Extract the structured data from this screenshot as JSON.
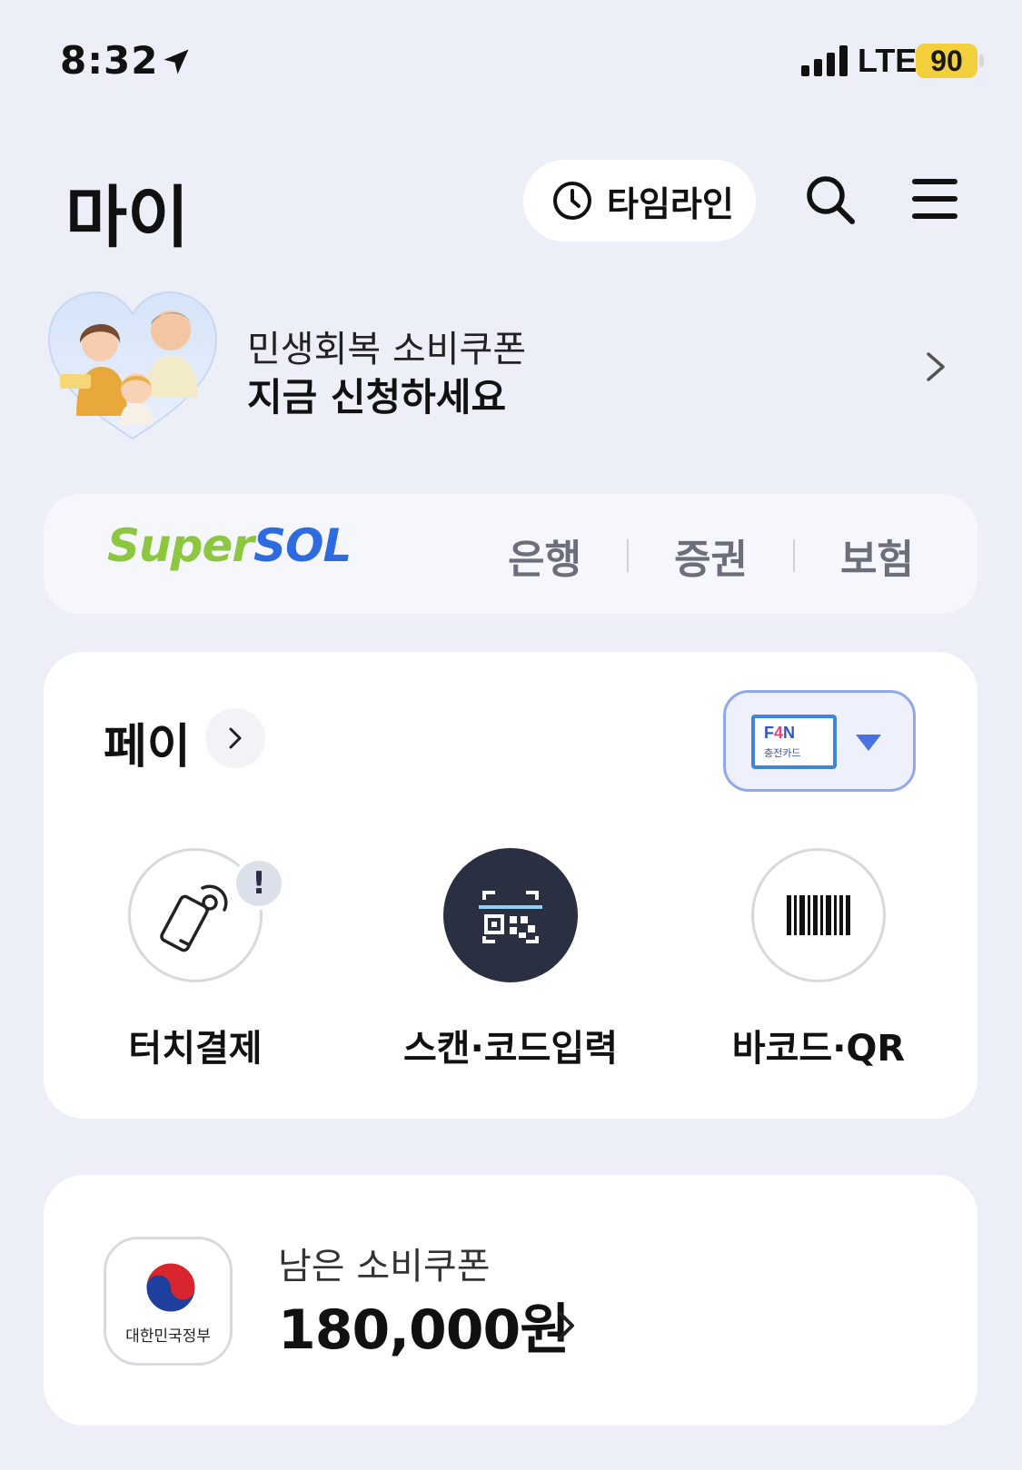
{
  "status_bar": {
    "time": "8:32",
    "network": "LTE",
    "battery": "90"
  },
  "header": {
    "title": "마이",
    "timeline_label": "타임라인"
  },
  "promo": {
    "line1": "민생회복 소비쿠폰",
    "line2": "지금 신청하세요"
  },
  "supersol": {
    "logo_super": "Super",
    "logo_sol": "SOL",
    "tabs": [
      {
        "label": "은행"
      },
      {
        "label": "증권"
      },
      {
        "label": "보험"
      }
    ]
  },
  "pay": {
    "title": "페이",
    "card": {
      "brand_a": "F",
      "brand_b": "4",
      "brand_c": "N",
      "sub": "충전카드"
    },
    "actions": [
      {
        "label": "터치결제",
        "icon": "phone-nfc-icon",
        "alert": "!"
      },
      {
        "label": "스캔·코드입력",
        "icon": "qr-scan-icon"
      },
      {
        "label": "바코드·QR",
        "icon": "barcode-icon"
      }
    ]
  },
  "coupon": {
    "gov_label": "대한민국정부",
    "label": "남은 소비쿠폰",
    "amount": "180,000원"
  },
  "colors": {
    "background": "#EDEFF8",
    "card": "#FFFFFF",
    "accent_blue": "#2E6BE0",
    "accent_green": "#8DC63F",
    "dark_button": "#2A3042",
    "battery": "#F3CF3C"
  }
}
